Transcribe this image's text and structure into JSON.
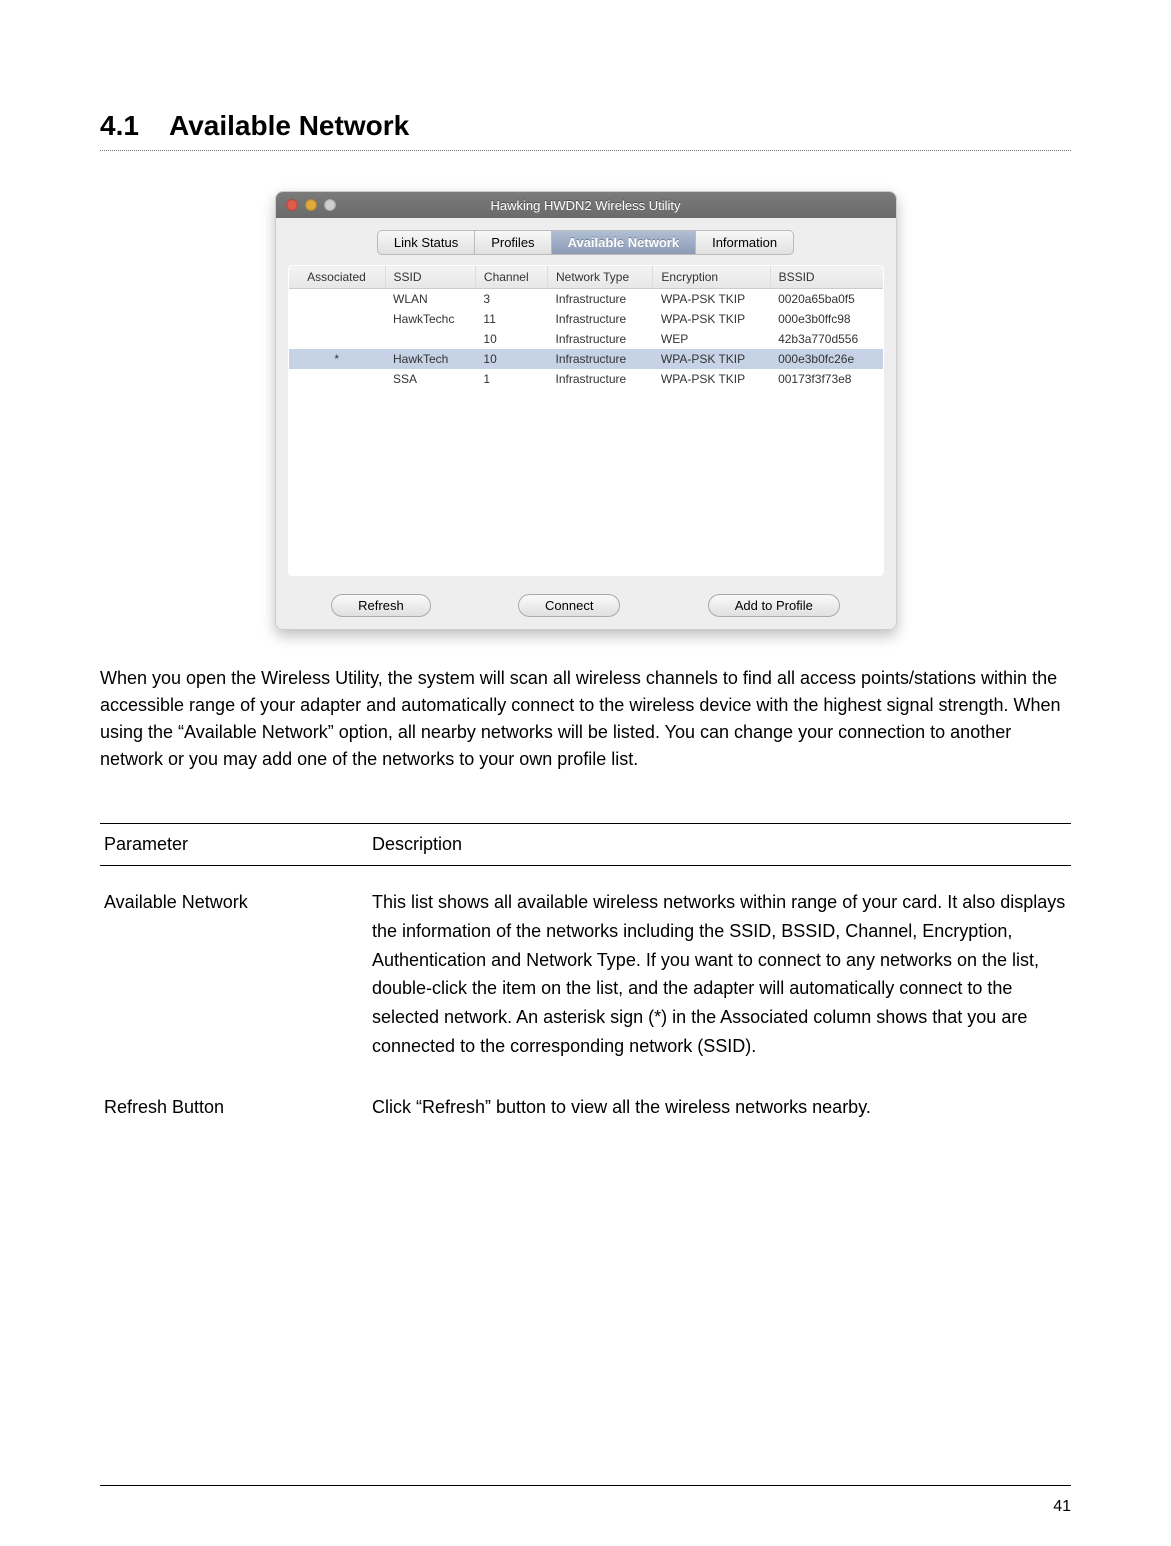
{
  "section": {
    "number": "4.1",
    "title": "Available Network"
  },
  "window": {
    "title": "Hawking HWDN2 Wireless Utility",
    "tabs": {
      "link_status": "Link Status",
      "profiles": "Profiles",
      "available_network": "Available Network",
      "information": "Information"
    },
    "table": {
      "headers": {
        "associated": "Associated",
        "ssid": "SSID",
        "channel": "Channel",
        "network_type": "Network Type",
        "encryption": "Encryption",
        "bssid": "BSSID"
      },
      "rows": [
        {
          "associated": "",
          "ssid": "WLAN",
          "channel": "3",
          "network_type": "Infrastructure",
          "encryption": "WPA-PSK TKIP",
          "bssid": "0020a65ba0f5",
          "selected": false
        },
        {
          "associated": "",
          "ssid": "HawkTechc",
          "channel": "11",
          "network_type": "Infrastructure",
          "encryption": "WPA-PSK TKIP",
          "bssid": "000e3b0ffc98",
          "selected": false
        },
        {
          "associated": "",
          "ssid": "",
          "channel": "10",
          "network_type": "Infrastructure",
          "encryption": "WEP",
          "bssid": "42b3a770d556",
          "selected": false
        },
        {
          "associated": "*",
          "ssid": "HawkTech",
          "channel": "10",
          "network_type": "Infrastructure",
          "encryption": "WPA-PSK TKIP",
          "bssid": "000e3b0fc26e",
          "selected": true
        },
        {
          "associated": "",
          "ssid": "SSA",
          "channel": "1",
          "network_type": "Infrastructure",
          "encryption": "WPA-PSK TKIP",
          "bssid": "00173f3f73e8",
          "selected": false
        }
      ]
    },
    "buttons": {
      "refresh": "Refresh",
      "connect": "Connect",
      "add_to_profile": "Add to Profile"
    }
  },
  "body_paragraph": "When you open the Wireless Utility, the system will scan all wireless channels to find all access points/stations within the accessible range of your adapter and automatically connect to the wireless device with the highest signal strength. When using the “Available Network” option, all nearby networks will be listed. You can change your connection to another network or you may add one of the networks to your own profile list.",
  "param_table": {
    "headers": {
      "parameter": "Parameter",
      "description": "Description"
    },
    "rows": [
      {
        "parameter": "Available Network",
        "description": "This list shows all available wireless networks within range of your card. It also displays the information of the networks including the SSID, BSSID, Channel, Encryption, Authentication and Network Type. If you want to connect to any networks on the list, double-click the item on the list, and the adapter will automatically connect to the selected network. An asterisk sign (*) in the Associated column shows that you are connected to the corresponding network (SSID)."
      },
      {
        "parameter": "Refresh Button",
        "description": "Click “Refresh” button to view all the wireless networks nearby."
      }
    ]
  },
  "page_number": "41"
}
